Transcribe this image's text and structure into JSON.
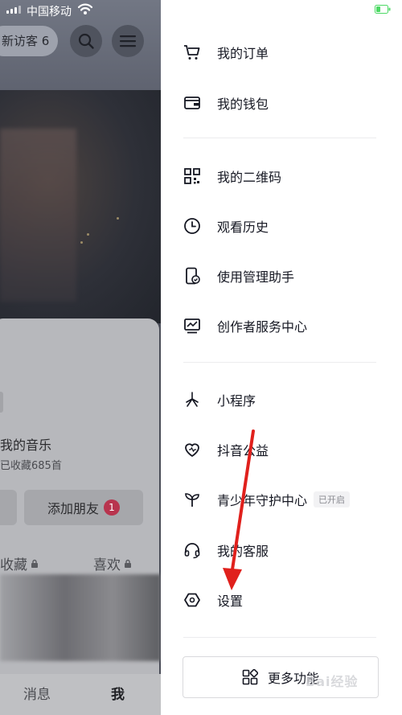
{
  "status_bar": {
    "carrier": "中国移动"
  },
  "profile_background": {
    "visitor_label": "新访客 6",
    "music_title": "我的音乐",
    "music_subtitle": "已收藏685首",
    "add_friend_label": "添加朋友",
    "add_friend_badge": "1",
    "tab_favorites": "收藏",
    "tab_likes": "喜欢",
    "nav_messages": "消息",
    "nav_me": "我"
  },
  "drawer": {
    "group1": [
      {
        "label": "我的订单",
        "icon": "cart-icon"
      },
      {
        "label": "我的钱包",
        "icon": "wallet-icon"
      }
    ],
    "group2": [
      {
        "label": "我的二维码",
        "icon": "qrcode-icon"
      },
      {
        "label": "观看历史",
        "icon": "clock-icon"
      },
      {
        "label": "使用管理助手",
        "icon": "phone-check-icon"
      },
      {
        "label": "创作者服务中心",
        "icon": "chart-icon"
      }
    ],
    "group3": [
      {
        "label": "小程序",
        "icon": "mini-program-icon"
      },
      {
        "label": "抖音公益",
        "icon": "heart-icon"
      },
      {
        "label": "青少年守护中心",
        "icon": "sprout-icon",
        "tag": "已开启"
      },
      {
        "label": "我的客服",
        "icon": "headset-icon"
      },
      {
        "label": "设置",
        "icon": "settings-hex-icon"
      }
    ],
    "more_functions": "更多功能"
  },
  "watermark": "Bai经验",
  "colors": {
    "drawer_bg": "#ffffff",
    "text_primary": "#161823",
    "badge_red": "#b8344e",
    "arrow_red": "#e0201c",
    "battery_green": "#4cd964"
  }
}
